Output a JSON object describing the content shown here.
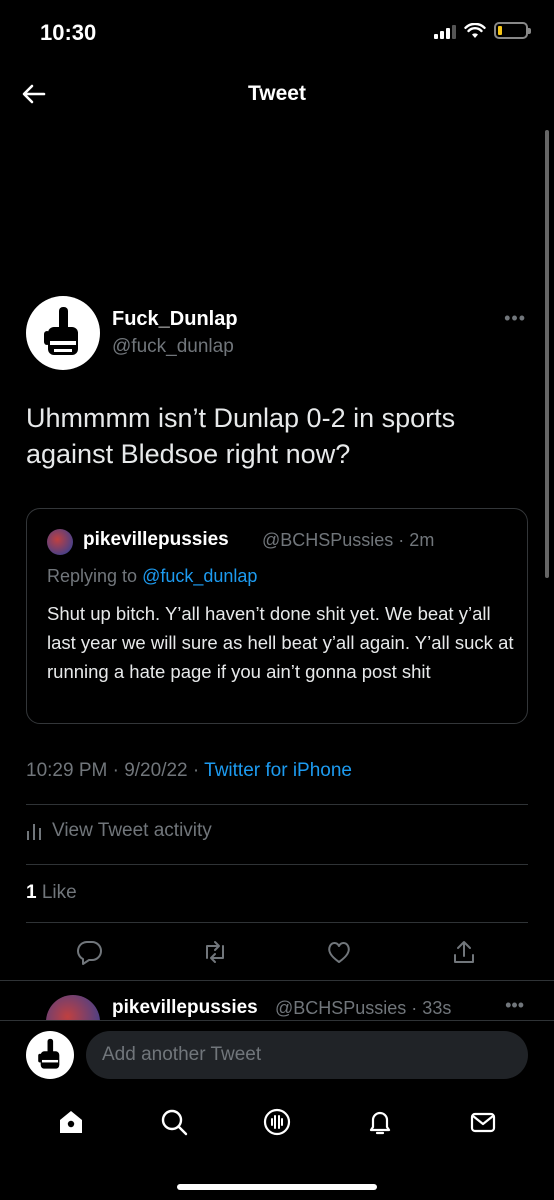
{
  "status_bar": {
    "time": "10:30"
  },
  "nav": {
    "title": "Tweet",
    "back_icon": "arrow-left-icon"
  },
  "tweet": {
    "author_name": "Fuck_Dunlap",
    "author_handle": "@fuck_dunlap",
    "text": "Uhmmmm isn’t Dunlap 0-2 in sports against Bledsoe right now?",
    "more_label": "•••",
    "quoted": {
      "author_name": "pikevillepussies",
      "author_handle": "@BCHSPussies · 2m",
      "reply_prefix": "Replying to ",
      "reply_handle": "@fuck_dunlap",
      "text": "Shut up bitch. Y’all haven’t done shit yet. We beat  y’all last year we will sure as hell beat y’all again. Y’all suck at running a hate page if you ain’t gonna post shit"
    },
    "timestamp": "10:29 PM · 9/20/22 · ",
    "source": "Twitter for iPhone",
    "activity_label": "View Tweet activity",
    "likes_count": "1",
    "likes_label": " Like"
  },
  "reply_preview": {
    "author_name": "pikevillepussies",
    "author_handle": "@BCHSPussies · 33s",
    "more_label": "•••"
  },
  "compose": {
    "placeholder": "Add another Tweet"
  },
  "tabs": [
    "home-icon",
    "search-icon",
    "spaces-icon",
    "notifications-icon",
    "messages-icon"
  ],
  "colors": {
    "accent": "#1d9bf0",
    "muted": "#71767b",
    "background": "#000000"
  }
}
